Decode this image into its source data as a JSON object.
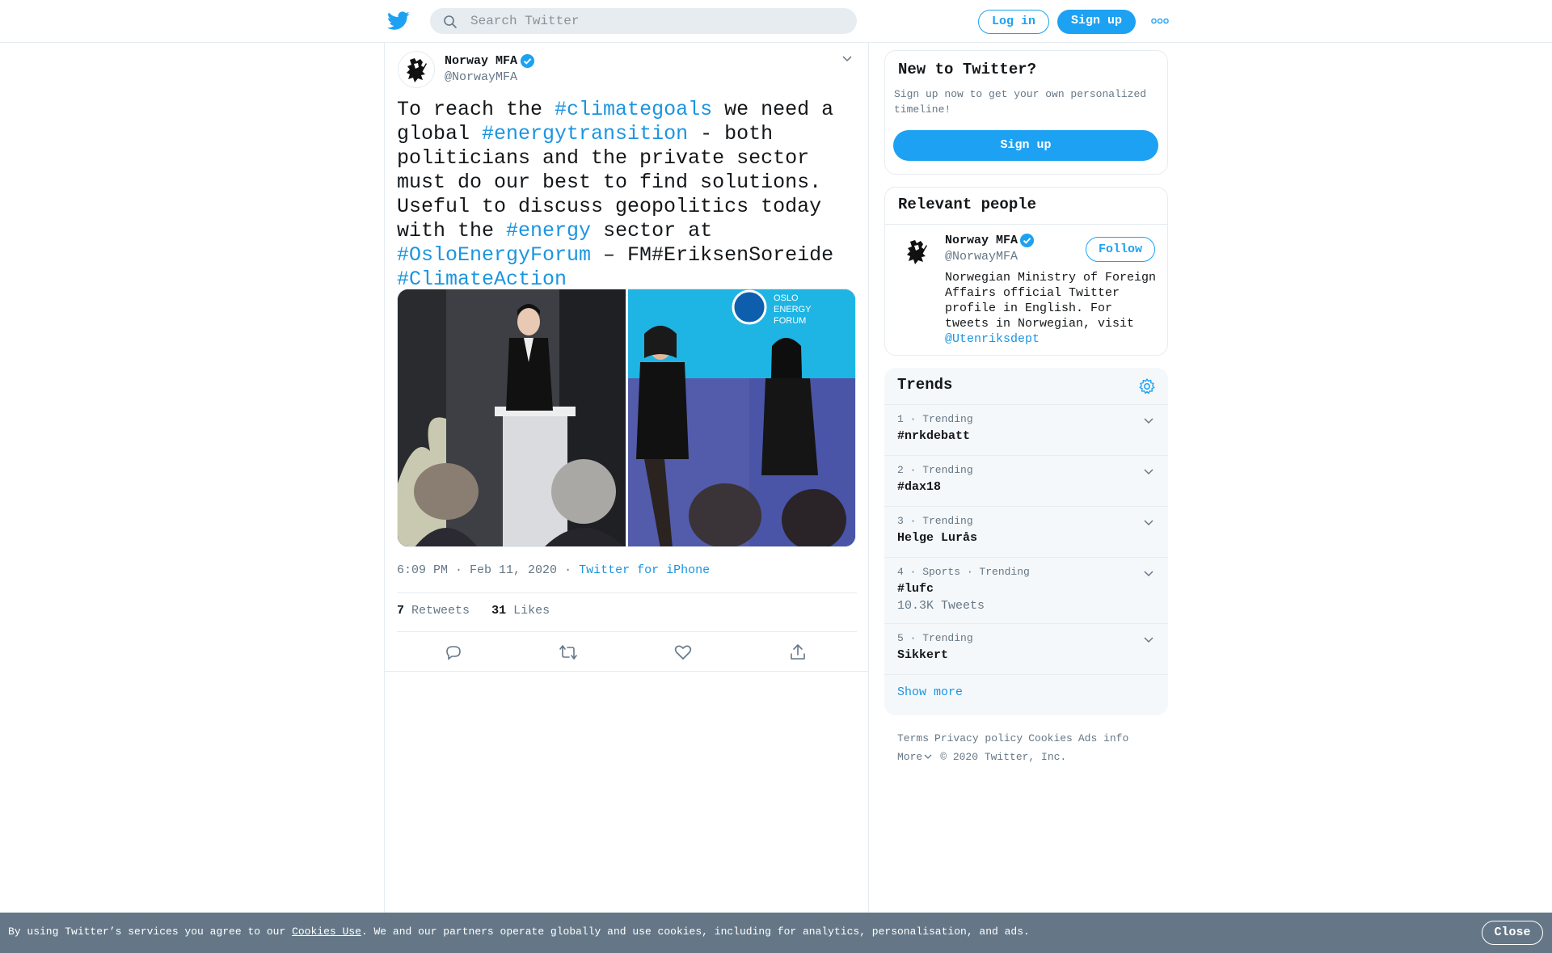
{
  "header": {
    "logo": "twitter-bird-icon",
    "search_placeholder": "Search Twitter",
    "login_label": "Log in",
    "signup_label": "Sign up",
    "more_icon": "more-dots-icon"
  },
  "tweet": {
    "author_name": "Norway MFA",
    "author_handle": "@NorwayMFA",
    "text_segments": [
      {
        "t": "To reach the ",
        "tag": false
      },
      {
        "t": "#climategoals",
        "tag": true
      },
      {
        "t": " we need a global ",
        "tag": false
      },
      {
        "t": "#energytransition",
        "tag": true
      },
      {
        "t": " - both politicians and the private sector must do our best to find solutions. Useful to discuss geopolitics today with the ",
        "tag": false
      },
      {
        "t": "#energy",
        "tag": true
      },
      {
        "t": " sector at ",
        "tag": false
      },
      {
        "t": "#OsloEnergyForum",
        "tag": true
      },
      {
        "t": " – FM#EriksenSoreide ",
        "tag": false
      },
      {
        "t": "#ClimateAction",
        "tag": true
      }
    ],
    "photo2_overlay": "OSLO ENERGY FORUM",
    "time": "6:09 PM · Feb 11, 2020",
    "dot": "·",
    "source": "Twitter for iPhone",
    "retweets_count": "7",
    "retweets_label": "Retweets",
    "likes_count": "31",
    "likes_label": "Likes"
  },
  "signup_card": {
    "title": "New to Twitter?",
    "subtitle": "Sign up now to get your own personalized timeline!",
    "button_label": "Sign up"
  },
  "relevant_people": {
    "title": "Relevant people",
    "name": "Norway MFA",
    "handle": "@NorwayMFA",
    "follow_label": "Follow",
    "bio": "Norwegian Ministry of Foreign Affairs official Twitter profile in English. For tweets in Norwegian, visit ",
    "bio_mention": "@Utenriksdept"
  },
  "trends": {
    "title": "Trends",
    "items": [
      {
        "meta": "1 · Trending",
        "name": "#nrkdebatt",
        "count": ""
      },
      {
        "meta": "2 · Trending",
        "name": "#dax18",
        "count": ""
      },
      {
        "meta": "3 · Trending",
        "name": "Helge Lurås",
        "count": ""
      },
      {
        "meta": "4 · Sports · Trending",
        "name": "#lufc",
        "count": "10.3K Tweets"
      },
      {
        "meta": "5 · Trending",
        "name": "Sikkert",
        "count": ""
      }
    ],
    "show_more": "Show more"
  },
  "footer": {
    "terms": "Terms",
    "privacy": "Privacy policy",
    "cookies": "Cookies",
    "ads": "Ads info",
    "more": "More",
    "copyright": "© 2020 Twitter, Inc."
  },
  "cookie_bar": {
    "prefix": "By using Twitter’s services you agree to our ",
    "link": "Cookies Use",
    "suffix": ". We and our partners operate globally and use cookies, including for analytics, personalisation, and ads.",
    "close_label": "Close"
  },
  "colors": {
    "accent": "#1da1f2",
    "link": "#1b95e0",
    "muted": "#657786",
    "cookie_bg": "#657786"
  }
}
